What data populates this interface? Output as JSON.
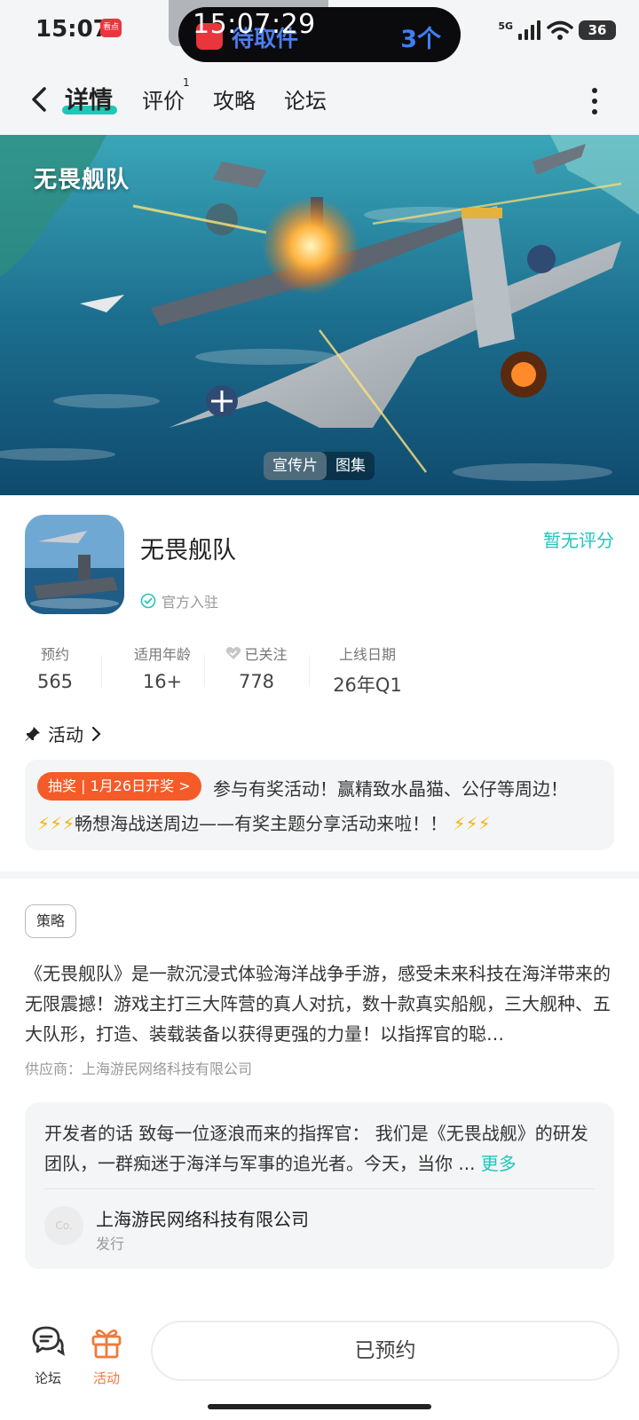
{
  "status_bar": {
    "time": "15:07",
    "app_icon_label": "看点",
    "island_clock": "15:07:29",
    "island_bg_text": "待取件",
    "island_count": "3个",
    "network": "5G",
    "battery": "36"
  },
  "nav": {
    "tabs": [
      {
        "label": "详情"
      },
      {
        "label": "评价"
      },
      {
        "label": "攻略"
      },
      {
        "label": "论坛"
      }
    ],
    "review_count": "1"
  },
  "hero": {
    "game_logo": "无畏舰队",
    "toggle": [
      "宣传片",
      "图集"
    ]
  },
  "app": {
    "name": "无畏舰队",
    "official_label": "官方入驻",
    "rating_text": "暂无评分"
  },
  "stats": [
    {
      "label": "预约",
      "value": "565"
    },
    {
      "label": "适用年龄",
      "value": "16+"
    },
    {
      "label": "已关注",
      "value": "778"
    },
    {
      "label": "上线日期",
      "value": "26年Q1"
    }
  ],
  "activity": {
    "heading": "活动",
    "badge": "抽奖 | 1月26日开奖 >",
    "line1": "参与有奖活动！赢精致水晶猫、公仔等周边！",
    "line2_bolts_left": "⚡⚡⚡",
    "line2_text": "畅想海战送周边——有奖主题分享活动来啦！！",
    "line2_bolts_right": "⚡⚡⚡"
  },
  "detail": {
    "tag": "策略",
    "description": "《无畏舰队》是一款沉浸式体验海洋战争手游，感受未来科技在海洋带来的无限震撼！游戏主打三大阵营的真人对抗，数十款真实船舰，三大舰种、五大队形，打造、装载装备以获得更强的力量！以指挥官的聪…",
    "supplier": "供应商：上海游民网络科技有限公司"
  },
  "developer": {
    "text": "开发者的话  致每一位逐浪而来的指挥官： 我们是《无畏战舰》的研发团队，一群痴迷于海洋与军事的追光者。今天，当你 ...",
    "more": "更多",
    "avatar_text": "Co.",
    "company": "上海游民网络科技有限公司",
    "role": "发行"
  },
  "bottom": {
    "forum_label": "论坛",
    "activity_label": "活动",
    "reserve_label": "已预约"
  },
  "colors": {
    "accent": "#1ec8b8",
    "badge": "#f45b29",
    "activity_icon": "#f07a3a",
    "panel": "#f4f5f7"
  }
}
